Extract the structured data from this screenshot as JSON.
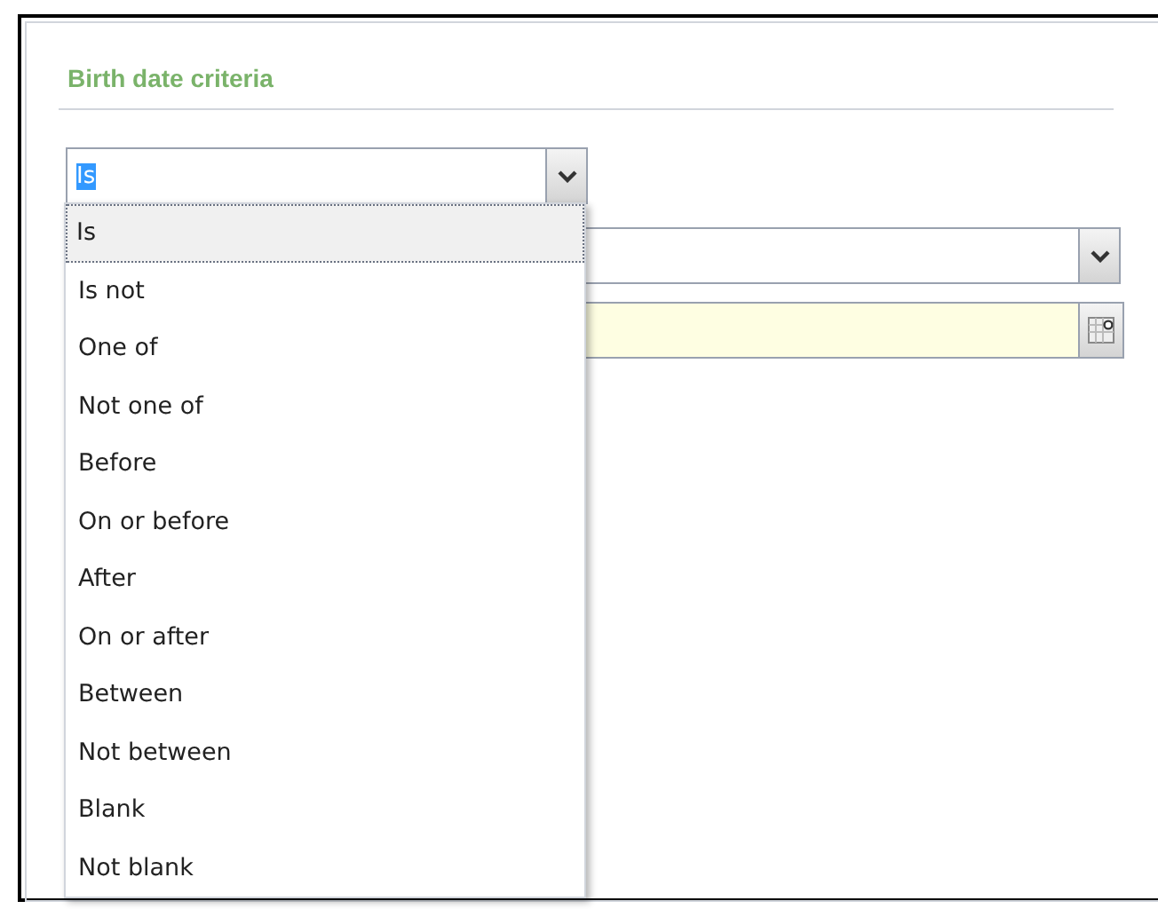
{
  "section": {
    "title": "Birth date criteria"
  },
  "operator_combo": {
    "value": "Is",
    "expanded": true
  },
  "options": [
    {
      "label": "Is",
      "selected": true
    },
    {
      "label": "Is not",
      "selected": false
    },
    {
      "label": "One of",
      "selected": false
    },
    {
      "label": "Not one of",
      "selected": false
    },
    {
      "label": "Before",
      "selected": false
    },
    {
      "label": "On or before",
      "selected": false
    },
    {
      "label": "After",
      "selected": false
    },
    {
      "label": "On or after",
      "selected": false
    },
    {
      "label": "Between",
      "selected": false
    },
    {
      "label": "Not between",
      "selected": false
    },
    {
      "label": "Blank",
      "selected": false
    },
    {
      "label": "Not blank",
      "selected": false
    }
  ]
}
